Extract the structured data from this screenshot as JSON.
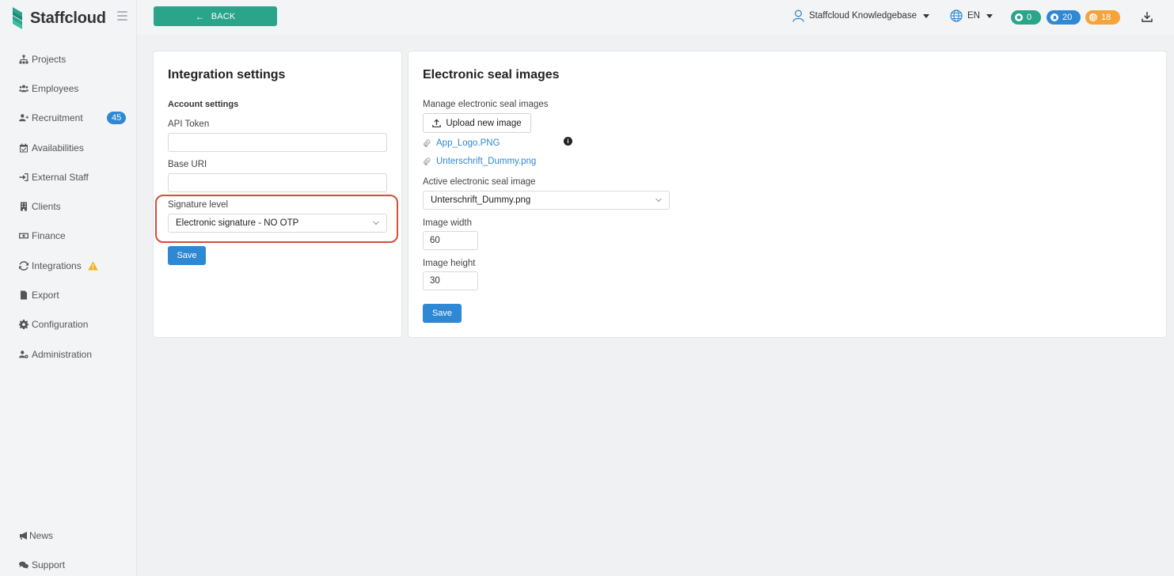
{
  "app": {
    "name": "Staffcloud",
    "brand_color": "#2aa48a"
  },
  "sidebar": {
    "items": [
      {
        "label": "Projects",
        "icon": "sitemap-icon"
      },
      {
        "label": "Employees",
        "icon": "users-icon"
      },
      {
        "label": "Recruitment",
        "icon": "user-plus-icon",
        "badge": "45"
      },
      {
        "label": "Availabilities",
        "icon": "calendar-check-icon"
      },
      {
        "label": "External Staff",
        "icon": "sign-in-icon"
      },
      {
        "label": "Clients",
        "icon": "building-icon"
      },
      {
        "label": "Finance",
        "icon": "money-icon"
      },
      {
        "label": "Integrations",
        "icon": "sync-icon",
        "warning": true
      },
      {
        "label": "Export",
        "icon": "file-icon"
      },
      {
        "label": "Configuration",
        "icon": "gear-icon"
      },
      {
        "label": "Administration",
        "icon": "user-cog-icon"
      }
    ],
    "bottom": [
      {
        "label": "News",
        "icon": "megaphone-icon"
      },
      {
        "label": "Support",
        "icon": "comments-icon"
      }
    ]
  },
  "topbar": {
    "back_label": "BACK",
    "user_name": "Staffcloud Knowledgebase",
    "language": "EN",
    "counters": {
      "messages": "0",
      "notifications": "20",
      "pending": "18"
    }
  },
  "integration": {
    "title": "Integration settings",
    "section": "Account settings",
    "api_token_label": "API Token",
    "api_token_value": "",
    "base_uri_label": "Base URI",
    "base_uri_value": "",
    "signature_label": "Signature level",
    "signature_value": "Electronic signature - NO OTP",
    "save_label": "Save"
  },
  "seal": {
    "title": "Electronic seal images",
    "manage_label": "Manage electronic seal images",
    "upload_label": "Upload new image",
    "files": [
      "App_Logo.PNG",
      "Unterschrift_Dummy.png"
    ],
    "active_label": "Active electronic seal image",
    "active_value": "Unterschrift_Dummy.png",
    "width_label": "Image width",
    "width_value": "60",
    "height_label": "Image height",
    "height_value": "30",
    "save_label": "Save"
  }
}
